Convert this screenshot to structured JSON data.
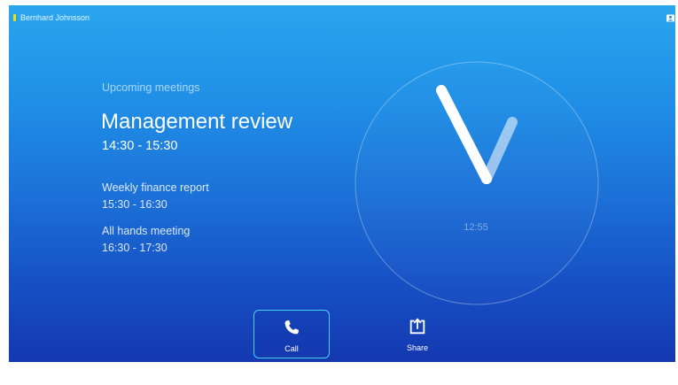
{
  "header": {
    "user_name": "Bernhard Johnsson",
    "status_color": "#f2e000",
    "contact_icon": "contact-card-icon"
  },
  "meetings": {
    "section_label": "Upcoming meetings",
    "featured": {
      "title": "Management review",
      "time": "14:30 - 15:30"
    },
    "list": [
      {
        "title": "Weekly finance report",
        "time": "15:30 - 16:30"
      },
      {
        "title": "All hands meeting",
        "time": "16:30 - 17:30"
      }
    ]
  },
  "clock": {
    "time": "12:55",
    "icon": "analog-clock-icon"
  },
  "actions": {
    "call": {
      "label": "Call",
      "icon": "phone-icon"
    },
    "share": {
      "label": "Share",
      "icon": "share-upload-icon"
    }
  },
  "colors": {
    "call_border": "#4ad0ff",
    "status": "#f2e000"
  }
}
